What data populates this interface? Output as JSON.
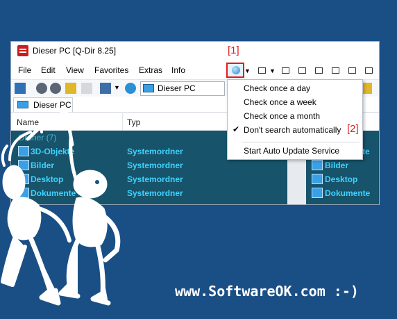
{
  "window": {
    "title": "Dieser PC  [Q-Dir 8.25]"
  },
  "menu": {
    "items": [
      "File",
      "Edit",
      "View",
      "Favorites",
      "Extras",
      "Info"
    ]
  },
  "address": {
    "value": "Dieser PC"
  },
  "tab": {
    "label": "Dieser PC"
  },
  "columns": {
    "name": "Name",
    "type": "Typ"
  },
  "list": {
    "group_header": "Ordner (7)",
    "rows": [
      {
        "name": "3D-Objekte",
        "type": "Systemordner"
      },
      {
        "name": "Bilder",
        "type": "Systemordner"
      },
      {
        "name": "Desktop",
        "type": "Systemordner"
      },
      {
        "name": "Dokumente",
        "type": "Systemordner"
      }
    ]
  },
  "right_list": {
    "partial": "te",
    "rows": [
      "Bilder",
      "Desktop",
      "Dokumente"
    ]
  },
  "dropdown": {
    "items": [
      {
        "label": "Check once a day",
        "checked": false
      },
      {
        "label": "Check once a week",
        "checked": false
      },
      {
        "label": "Check once a month",
        "checked": false
      },
      {
        "label": "Don't search automatically",
        "checked": true
      },
      {
        "label": "Start Auto Update Service",
        "checked": false
      }
    ],
    "check_glyph": "✔"
  },
  "annotations": {
    "marker1": "[1]",
    "marker2": "[2]"
  },
  "footer": {
    "text": "www.SoftwareOK.com :-)"
  },
  "colors": {
    "background": "#1a4f86",
    "highlight": "#e21b1b",
    "list_bg": "#17536a",
    "list_text": "#3fd2ff"
  }
}
